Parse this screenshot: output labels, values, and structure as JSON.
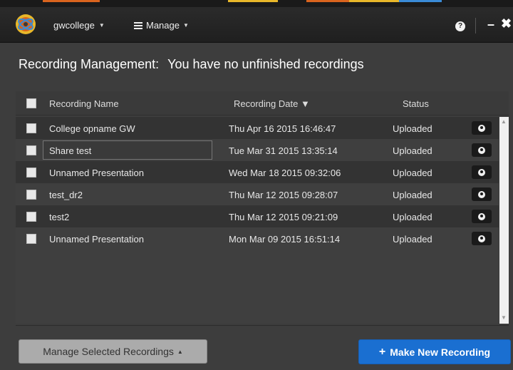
{
  "header": {
    "user_menu": "gwcollege",
    "manage_menu": "Manage",
    "help_glyph": "?",
    "minimize_glyph": "–",
    "close_glyph": "✖",
    "strip_colors": [
      "#1a1a1a",
      "#d9641e",
      "#1a1a1a",
      "#e8b72a",
      "#1a1a1a",
      "#d9641e",
      "#e8b72a",
      "#3a8bd6"
    ]
  },
  "page": {
    "heading_label": "Recording Management:",
    "heading_status": "You have no unfinished recordings"
  },
  "table": {
    "columns": {
      "name": "Recording Name",
      "date": "Recording Date",
      "sort_glyph": "▼",
      "status": "Status"
    },
    "rows": [
      {
        "name": "College opname GW",
        "date": "Thu Apr 16 2015 16:46:47",
        "status": "Uploaded"
      },
      {
        "name": "Share test",
        "date": "Tue Mar 31 2015 13:35:14",
        "status": "Uploaded"
      },
      {
        "name": "Unnamed Presentation",
        "date": "Wed Mar 18 2015 09:32:06",
        "status": "Uploaded"
      },
      {
        "name": "test_dr2",
        "date": "Thu Mar 12 2015 09:28:07",
        "status": "Uploaded"
      },
      {
        "name": "test2",
        "date": "Thu Mar 12 2015 09:21:09",
        "status": "Uploaded"
      },
      {
        "name": "Unnamed Presentation",
        "date": "Mon Mar 09 2015 16:51:14",
        "status": "Uploaded"
      }
    ]
  },
  "footer": {
    "manage_selected": "Manage Selected Recordings",
    "manage_caret": "▲",
    "new_recording": "Make New Recording",
    "new_plus": "+"
  }
}
